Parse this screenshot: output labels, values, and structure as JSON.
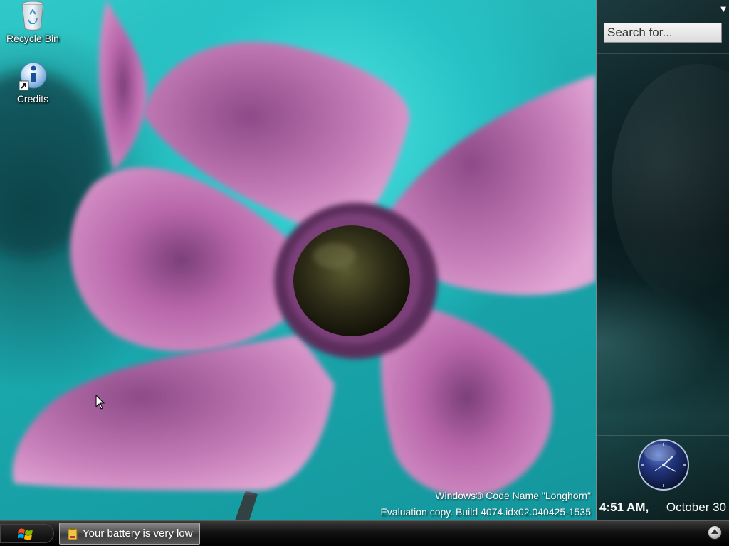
{
  "desktop": {
    "icons": [
      {
        "label": "Recycle Bin",
        "icon": "recycle-bin-icon"
      },
      {
        "label": "Credits",
        "icon": "info-shortcut-icon"
      }
    ],
    "watermark": {
      "line1": "Windows® Code Name \"Longhorn\"",
      "line2": "Evaluation copy. Build 4074.idx02.040425-1535"
    }
  },
  "sidebar": {
    "menu_icon": "chevron-down-icon",
    "search": {
      "placeholder": "Search for..."
    },
    "clock": {
      "time": "4:51 AM,",
      "date": "October 30"
    }
  },
  "taskbar": {
    "start_icon": "windows-logo-icon",
    "tasks": [
      {
        "label": "Your battery is very low",
        "icon": "battery-icon"
      }
    ],
    "tray_expand_icon": "tray-expand-icon"
  },
  "colors": {
    "wallpaper_teal": "#27c3c6",
    "flower_pink": "#c06bb0",
    "sidebar_dark": "#0b1c20",
    "taskbar_black": "#111111"
  }
}
